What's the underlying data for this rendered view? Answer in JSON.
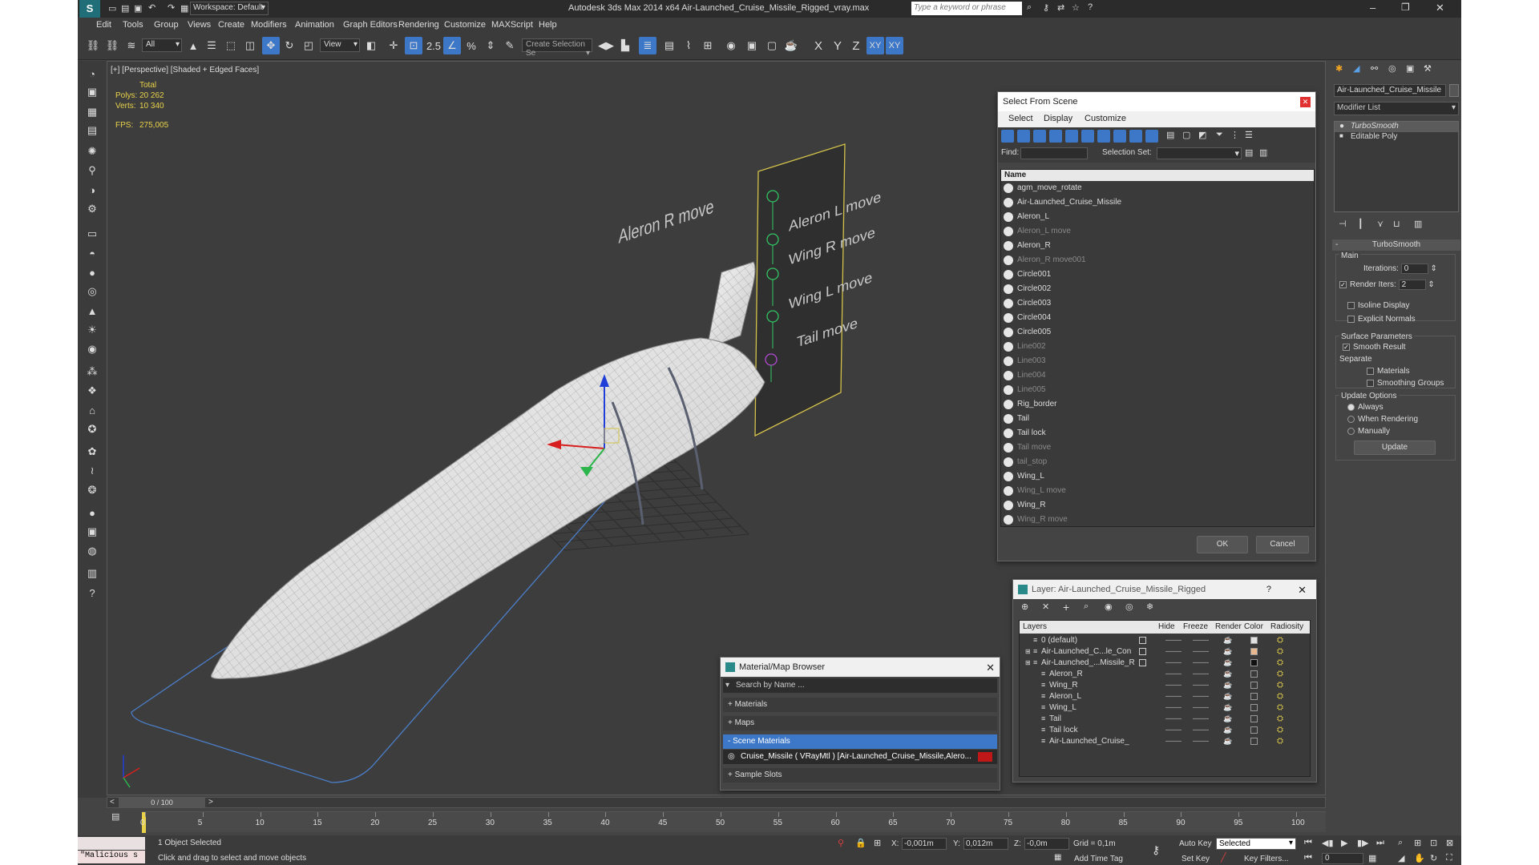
{
  "titlebar": {
    "workspace": "Workspace: Default",
    "app_title": "Autodesk 3ds Max  2014 x64    Air-Launched_Cruise_Missile_Rigged_vray.max",
    "search_placeholder": "Type a keyword or phrase"
  },
  "menu": [
    "Edit",
    "Tools",
    "Group",
    "Views",
    "Create",
    "Modifiers",
    "Animation",
    "Graph Editors",
    "Rendering",
    "Customize",
    "MAXScript",
    "Help"
  ],
  "toolbar": {
    "filter_select": "All",
    "ref_coord": "View",
    "selection_set": "Create Selection Se",
    "axis_x": "X",
    "axis_y": "Y",
    "axis_z": "Z",
    "axis_xy": "XY",
    "axis_xy2": "XY"
  },
  "viewport": {
    "label": "[+] [Perspective] [Shaded + Edged Faces]",
    "stats_total": "Total",
    "polys_label": "Polys:",
    "polys_value": "20 262",
    "verts_label": "Verts:",
    "verts_value": "10 340",
    "fps_label": "FPS:",
    "fps_value": "275,005",
    "rig_labels": [
      "Aleron R move",
      "Aleron L move",
      "Wing R move",
      "Wing L move",
      "Tail move"
    ]
  },
  "command_panel": {
    "object_name": "Air-Launched_Cruise_Missile",
    "modifier_list": "Modifier List",
    "stack": [
      "TurboSmooth",
      "Editable Poly"
    ],
    "rollout_title": "TurboSmooth",
    "main_label": "Main",
    "iterations_label": "Iterations:",
    "iterations_value": "0",
    "render_iters_label": "Render Iters:",
    "render_iters_value": "2",
    "isoline": "Isoline Display",
    "explicit_normals": "Explicit Normals",
    "surface_params": "Surface Parameters",
    "smooth_result": "Smooth Result",
    "separate": "Separate",
    "materials": "Materials",
    "smoothing_groups": "Smoothing Groups",
    "update_options": "Update Options",
    "always": "Always",
    "when_rendering": "When Rendering",
    "manually": "Manually",
    "update_btn": "Update"
  },
  "select_dialog": {
    "title": "Select From Scene",
    "tabs": [
      "Select",
      "Display",
      "Customize"
    ],
    "find_label": "Find:",
    "selection_set_label": "Selection Set:",
    "col_name": "Name",
    "items": [
      {
        "name": "agm_move_rotate",
        "dim": false
      },
      {
        "name": "Air-Launched_Cruise_Missile",
        "dim": false
      },
      {
        "name": "Aleron_L",
        "dim": false
      },
      {
        "name": "Aleron_L move",
        "dim": true
      },
      {
        "name": "Aleron_R",
        "dim": false
      },
      {
        "name": "Aleron_R move001",
        "dim": true
      },
      {
        "name": "Circle001",
        "dim": false
      },
      {
        "name": "Circle002",
        "dim": false
      },
      {
        "name": "Circle003",
        "dim": false
      },
      {
        "name": "Circle004",
        "dim": false
      },
      {
        "name": "Circle005",
        "dim": false
      },
      {
        "name": "Line002",
        "dim": true
      },
      {
        "name": "Line003",
        "dim": true
      },
      {
        "name": "Line004",
        "dim": true
      },
      {
        "name": "Line005",
        "dim": true
      },
      {
        "name": "Rig_border",
        "dim": false
      },
      {
        "name": "Tail",
        "dim": false
      },
      {
        "name": "Tail lock",
        "dim": false
      },
      {
        "name": "Tail move",
        "dim": true
      },
      {
        "name": "tail_stop",
        "dim": true
      },
      {
        "name": "Wing_L",
        "dim": false
      },
      {
        "name": "Wing_L move",
        "dim": true
      },
      {
        "name": "Wing_R",
        "dim": false
      },
      {
        "name": "Wing_R move",
        "dim": true
      }
    ],
    "ok": "OK",
    "cancel": "Cancel"
  },
  "layer_dialog": {
    "title": "Layer: Air-Launched_Cruise_Missile_Rigged",
    "help": "?",
    "cols": [
      "Layers",
      "Hide",
      "Freeze",
      "Render",
      "Color",
      "Radiosity"
    ],
    "rows": [
      {
        "name": "0 (default)",
        "indent": 1,
        "color": "#e0e0e0"
      },
      {
        "name": "Air-Launched_C...le_Con",
        "indent": 1,
        "color": "#e8b890"
      },
      {
        "name": "Air-Launched_...Missile_R",
        "indent": 1,
        "color": "#111111"
      },
      {
        "name": "Aleron_R",
        "indent": 2,
        "color": "#3a3a3a"
      },
      {
        "name": "Wing_R",
        "indent": 2,
        "color": "#3a3a3a"
      },
      {
        "name": "Aleron_L",
        "indent": 2,
        "color": "#3a3a3a"
      },
      {
        "name": "Wing_L",
        "indent": 2,
        "color": "#3a3a3a"
      },
      {
        "name": "Tail",
        "indent": 2,
        "color": "#3a3a3a"
      },
      {
        "name": "Tail lock",
        "indent": 2,
        "color": "#3a3a3a"
      },
      {
        "name": "Air-Launched_Cruise_",
        "indent": 2,
        "color": "#3a3a3a"
      }
    ]
  },
  "material_browser": {
    "title": "Material/Map Browser",
    "search_placeholder": "Search by Name ...",
    "sections": [
      "+ Materials",
      "+ Maps",
      "- Scene Materials",
      "+ Sample Slots"
    ],
    "scene_material": "Cruise_Missile ( VRayMtl ) [Air-Launched_Cruise_Missile,Alero..."
  },
  "timeline": {
    "frame": "0 / 100",
    "ticks": [
      "0",
      "5",
      "10",
      "15",
      "20",
      "25",
      "30",
      "35",
      "40",
      "45",
      "50",
      "55",
      "60",
      "65",
      "70",
      "75",
      "80",
      "85",
      "90",
      "95",
      "100"
    ]
  },
  "status": {
    "script": "\"Malicious s",
    "selected": "1 Object Selected",
    "prompt": "Click and drag to select and move objects",
    "x_label": "X:",
    "x_value": "-0,001m",
    "y_label": "Y:",
    "y_value": "0,012m",
    "z_label": "Z:",
    "z_value": "-0,0m",
    "grid": "Grid = 0,1m",
    "add_time_tag": "Add Time Tag",
    "auto_key": "Auto Key",
    "set_key": "Set Key",
    "key_mode": "Selected",
    "key_filters": "Key Filters...",
    "frame_value": "0"
  },
  "colors": {
    "accent": "#3d78c8",
    "bg": "#444444",
    "viewport": "#3d3d3d",
    "close": "#e03030"
  }
}
